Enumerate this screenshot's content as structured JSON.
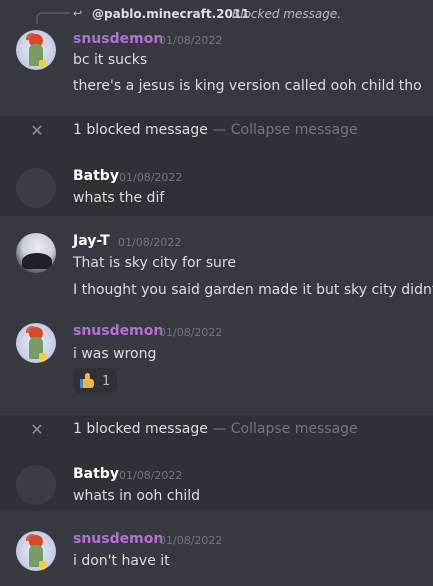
{
  "reply": {
    "username": "@pablo.minecraft.2011",
    "blocked_label": "Blocked message."
  },
  "messages": [
    {
      "author": "snusdemon",
      "timestamp": "01/08/2022",
      "lines": [
        "bc it sucks",
        "there's a jesus is king version called ooh child tho"
      ]
    },
    {
      "author": "Batby",
      "timestamp": "01/08/2022",
      "lines": [
        "whats the dif"
      ]
    },
    {
      "author": "Jay-T",
      "timestamp": "01/08/2022",
      "lines": [
        "That is sky city for sure",
        "I thought you said garden made it but sky city didnt"
      ]
    },
    {
      "author": "snusdemon",
      "timestamp": "01/08/2022",
      "lines": [
        "i was wrong"
      ],
      "reaction": {
        "emoji": "thumbs-up",
        "count": "1"
      }
    },
    {
      "author": "Batby",
      "timestamp": "01/08/2022",
      "lines": [
        "whats in ooh child"
      ]
    },
    {
      "author": "snusdemon",
      "timestamp": "01/08/2022",
      "lines": [
        "i don't have it"
      ]
    }
  ],
  "blocked_notice": {
    "count_text": "1 blocked message",
    "separator": "—",
    "collapse_text": "Collapse message"
  },
  "colors": {
    "background": "#36393f",
    "blocked_background": "#2f3136",
    "snusdemon_name": "#b36fd6",
    "default_name": "#ffffff",
    "timestamp": "#72767d"
  }
}
